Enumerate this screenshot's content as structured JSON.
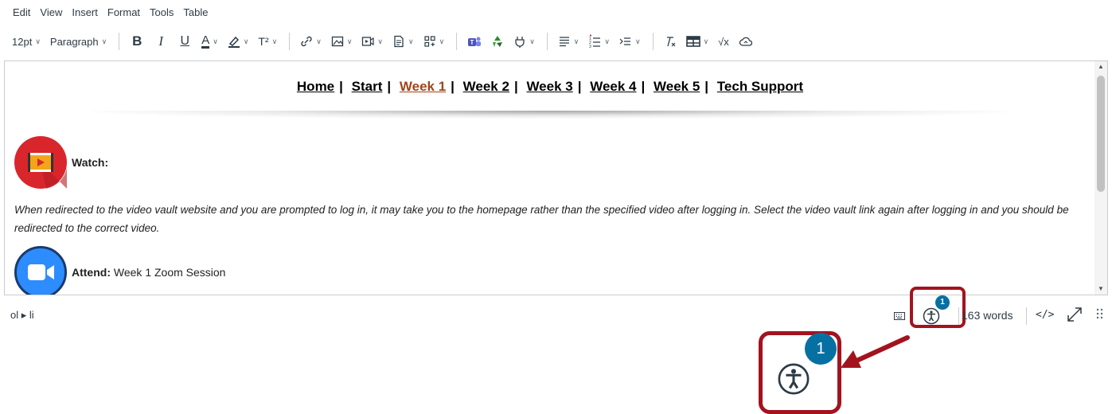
{
  "menubar": [
    "Edit",
    "View",
    "Insert",
    "Format",
    "Tools",
    "Table"
  ],
  "toolbar": {
    "font_size": "12pt",
    "block_format": "Paragraph"
  },
  "editor": {
    "nav_links": [
      "Home",
      "Start",
      "Week 1",
      "Week 2",
      "Week 3",
      "Week 4",
      "Week 5",
      "Tech Support"
    ],
    "nav_current": "Week 1",
    "watch_label": "Watch:",
    "paragraph": "When redirected to the video vault website and you are prompted to log in, it may take you to the homepage rather than the specified video after logging in. Select the video vault link again after logging in and you should be redirected to the correct video.",
    "attend_label": "Attend:",
    "attend_text": " Week 1 Zoom Session"
  },
  "statusbar": {
    "path": "ol ▸ li",
    "a11y_issue_count": "1",
    "word_count": "163 words",
    "html_toggle": "</>"
  },
  "callout": {
    "issue_count": "1"
  },
  "colors": {
    "highlight": "#a3131e",
    "badge": "#0770a3",
    "current_link": "#a0451a"
  }
}
